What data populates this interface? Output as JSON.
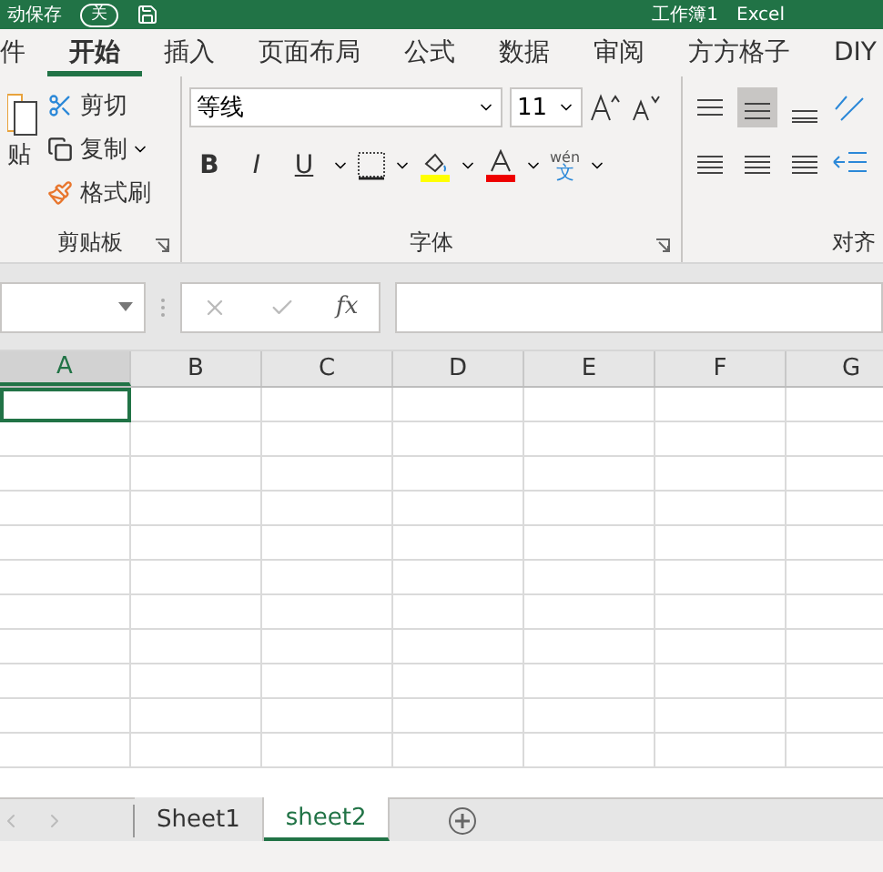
{
  "title_bar": {
    "autosave_label": "动保存",
    "autosave_state": "关",
    "title": "工作簿1",
    "app": "Excel"
  },
  "tabs": [
    {
      "label": "件",
      "selected": false
    },
    {
      "label": "开始",
      "selected": true
    },
    {
      "label": "插入",
      "selected": false
    },
    {
      "label": "页面布局",
      "selected": false
    },
    {
      "label": "公式",
      "selected": false
    },
    {
      "label": "数据",
      "selected": false
    },
    {
      "label": "审阅",
      "selected": false
    },
    {
      "label": "方方格子",
      "selected": false
    },
    {
      "label": "DIY",
      "selected": false
    }
  ],
  "clipboard": {
    "paste": "贴",
    "cut": "剪切",
    "copy": "复制",
    "format_painter": "格式刷",
    "label": "剪贴板"
  },
  "font": {
    "name": "等线",
    "size": "11",
    "bold": "B",
    "italic": "I",
    "underline": "U",
    "label": "字体",
    "phonetic": "wén",
    "phonetic_char": "文"
  },
  "alignment": {
    "label": "对齐",
    "vertical": [
      {
        "selected": false
      },
      {
        "selected": true
      },
      {
        "selected": false
      }
    ]
  },
  "formula_bar": {
    "fx": "fx"
  },
  "columns": [
    {
      "label": "A",
      "selected": true
    },
    {
      "label": "B",
      "selected": false
    },
    {
      "label": "C",
      "selected": false
    },
    {
      "label": "D",
      "selected": false
    },
    {
      "label": "E",
      "selected": false
    },
    {
      "label": "F",
      "selected": false
    },
    {
      "label": "G",
      "selected": false
    }
  ],
  "sheets": [
    {
      "label": "Sheet1",
      "selected": false
    },
    {
      "label": "sheet2",
      "selected": true
    }
  ]
}
